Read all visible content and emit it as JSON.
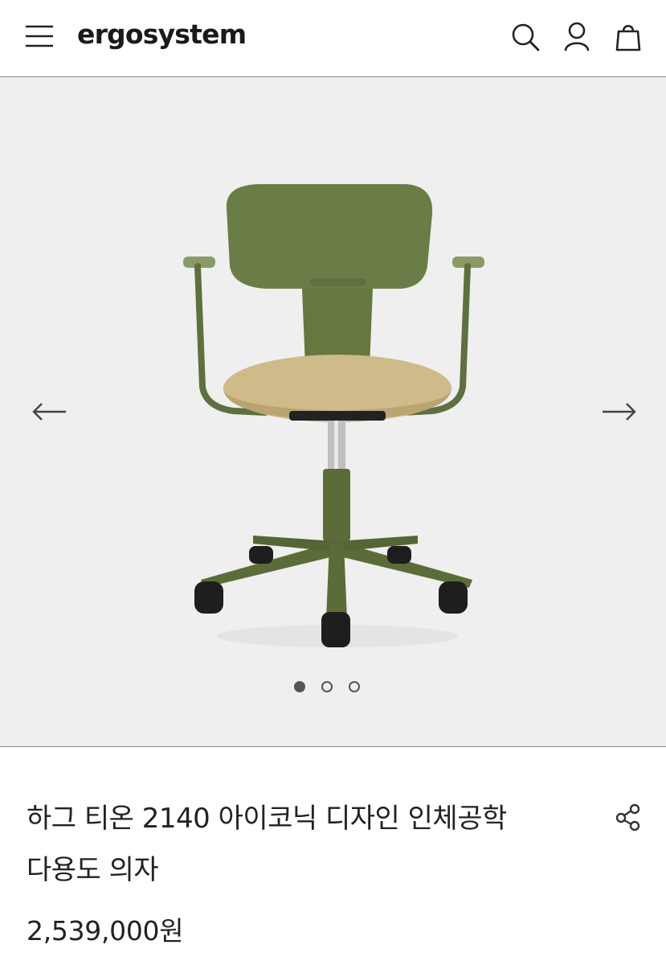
{
  "header": {
    "logo": "ergosystem",
    "menu_icon": "hamburger-menu-icon",
    "search_icon": "search-icon",
    "account_icon": "user-icon",
    "cart_icon": "shopping-bag-icon"
  },
  "gallery": {
    "prev_icon": "arrow-left-icon",
    "next_icon": "arrow-right-icon",
    "image": "chair-product-image",
    "dots": [
      {
        "state": "active"
      },
      {
        "state": "inactive"
      },
      {
        "state": "inactive"
      }
    ],
    "background": "#efefef",
    "chair_colors": {
      "frame": "#6b7d47",
      "seat": "#cfba8a"
    }
  },
  "product": {
    "title_line1": "하그 티온 2140 아이코닉 디자인 인체공학",
    "title_line2": "다용도 의자",
    "price": "2,539,000원",
    "share_icon": "share-icon"
  }
}
